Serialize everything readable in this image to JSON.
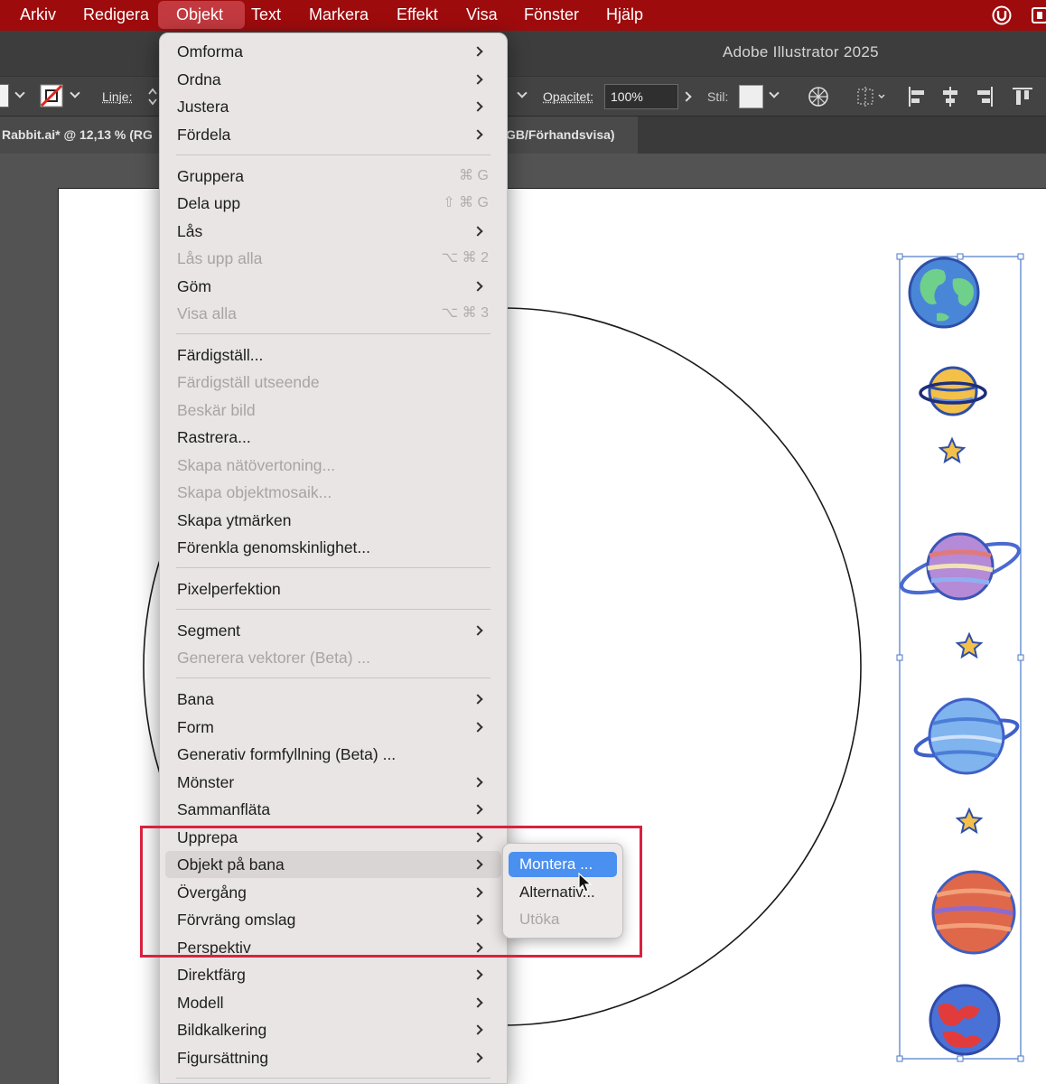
{
  "menubar": {
    "items": [
      "Arkiv",
      "Redigera",
      "Objekt",
      "Text",
      "Markera",
      "Effekt",
      "Visa",
      "Fönster",
      "Hjälp"
    ],
    "active": "Objekt"
  },
  "app_title": "Adobe Illustrator 2025",
  "controlbar": {
    "linje_label": "Linje:",
    "opacitet_label": "Opacitet:",
    "opacitet_value": "100%",
    "stil_label": "Stil:"
  },
  "tabs": {
    "doc_tab_left": "Rabbit.ai* @ 12,13 % (RG",
    "doc_tab_right": "GB/Förhandsvisa)"
  },
  "menu": {
    "omforma": "Omforma",
    "ordna": "Ordna",
    "justera": "Justera",
    "fordela": "Fördela",
    "gruppera": "Gruppera",
    "gruppera_sc": "⌘ G",
    "dela_upp": "Dela upp",
    "dela_upp_sc": "⇧ ⌘ G",
    "las": "Lås",
    "las_upp_alla": "Lås upp alla",
    "las_upp_alla_sc": "⌥ ⌘ 2",
    "gom": "Göm",
    "visa_alla": "Visa alla",
    "visa_alla_sc": "⌥ ⌘ 3",
    "fardigstall": "Färdigställ...",
    "fardigstall_utseende": "Färdigställ utseende",
    "beskar_bild": "Beskär bild",
    "rastrera": "Rastrera...",
    "skapa_natovertoning": "Skapa nätövertoning...",
    "skapa_objektmosaik": "Skapa objektmosaik...",
    "skapa_ytmarken": "Skapa ytmärken",
    "forenkla": "Förenkla genomskinlighet...",
    "pixelperfektion": "Pixelperfektion",
    "segment": "Segment",
    "generera_vektorer": "Generera vektorer (Beta) ...",
    "bana": "Bana",
    "form": "Form",
    "generativ": "Generativ formfyllning (Beta) ...",
    "monster": "Mönster",
    "sammanflata": "Sammanfläta",
    "upprepa": "Upprepa",
    "objekt_pa_bana": "Objekt på bana",
    "overgang": "Övergång",
    "forvrang": "Förvräng omslag",
    "perspektiv": "Perspektiv",
    "direktfarg": "Direktfärg",
    "modell": "Modell",
    "bildkalkering": "Bildkalkering",
    "figursattning": "Figursättning"
  },
  "submenu": {
    "montera": "Montera ...",
    "alternativ": "Alternativ...",
    "utoka": "Utöka"
  },
  "colors": {
    "menubar_bg": "#9e0b0d",
    "selection_blue": "#4a90f0",
    "highlight_red": "#d9213f",
    "bbox_blue": "#4a78c8"
  }
}
